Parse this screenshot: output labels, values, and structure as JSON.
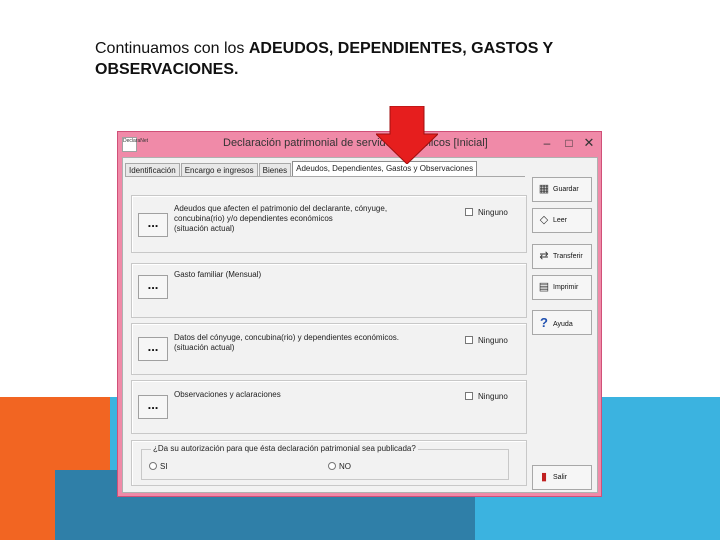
{
  "slide": {
    "title_prefix": "Continuamos con los ",
    "title_bold": "ADEUDOS, DEPENDIENTES, GASTOS Y OBSERVACIONES."
  },
  "window": {
    "icon_text": "DeclaraNet",
    "title": "Declaración patrimonial de servidores públicos [Inicial]",
    "minimize": "–",
    "maximize": "□",
    "close": "✕"
  },
  "tabs": [
    {
      "label": "Identificación"
    },
    {
      "label": "Encargo e ingresos"
    },
    {
      "label": "Bienes"
    },
    {
      "label": "Adeudos, Dependientes, Gastos y Observaciones"
    }
  ],
  "sections": [
    {
      "button": "...",
      "line1": "Adeudos que afecten el patrimonio del declarante, cónyuge,",
      "line2": "concubina(rio) y/o dependientes económicos",
      "line3": "(situación actual)",
      "checkbox": "Ninguno"
    },
    {
      "button": "...",
      "line1": "Gasto familiar (Mensual)"
    },
    {
      "button": "...",
      "line1": "Datos del cónyuge, concubina(rio) y dependientes económicos.",
      "line2": "(situación actual)",
      "checkbox": "Ninguno"
    },
    {
      "button": "...",
      "line1": "Observaciones y aclaraciones",
      "checkbox": "Ninguno"
    }
  ],
  "question": {
    "text": "¿Da su autorización para que ésta declaración patrimonial sea publicada?",
    "yes": "SI",
    "no": "NO"
  },
  "side_buttons": [
    {
      "icon": "save-icon",
      "label": "Guardar"
    },
    {
      "icon": "read-icon",
      "label": "Leer"
    },
    {
      "icon": "transfer-icon",
      "label": "Transferir"
    },
    {
      "icon": "print-icon",
      "label": "Imprimir"
    },
    {
      "icon": "help-icon",
      "label": "Ayuda"
    },
    {
      "icon": "exit-icon",
      "label": "Salir"
    }
  ],
  "colors": {
    "window_frame": "#f08aa8",
    "arrow": "#e61e1e",
    "deco_orange": "#f26522",
    "deco_blue": "#3bb3e0"
  }
}
